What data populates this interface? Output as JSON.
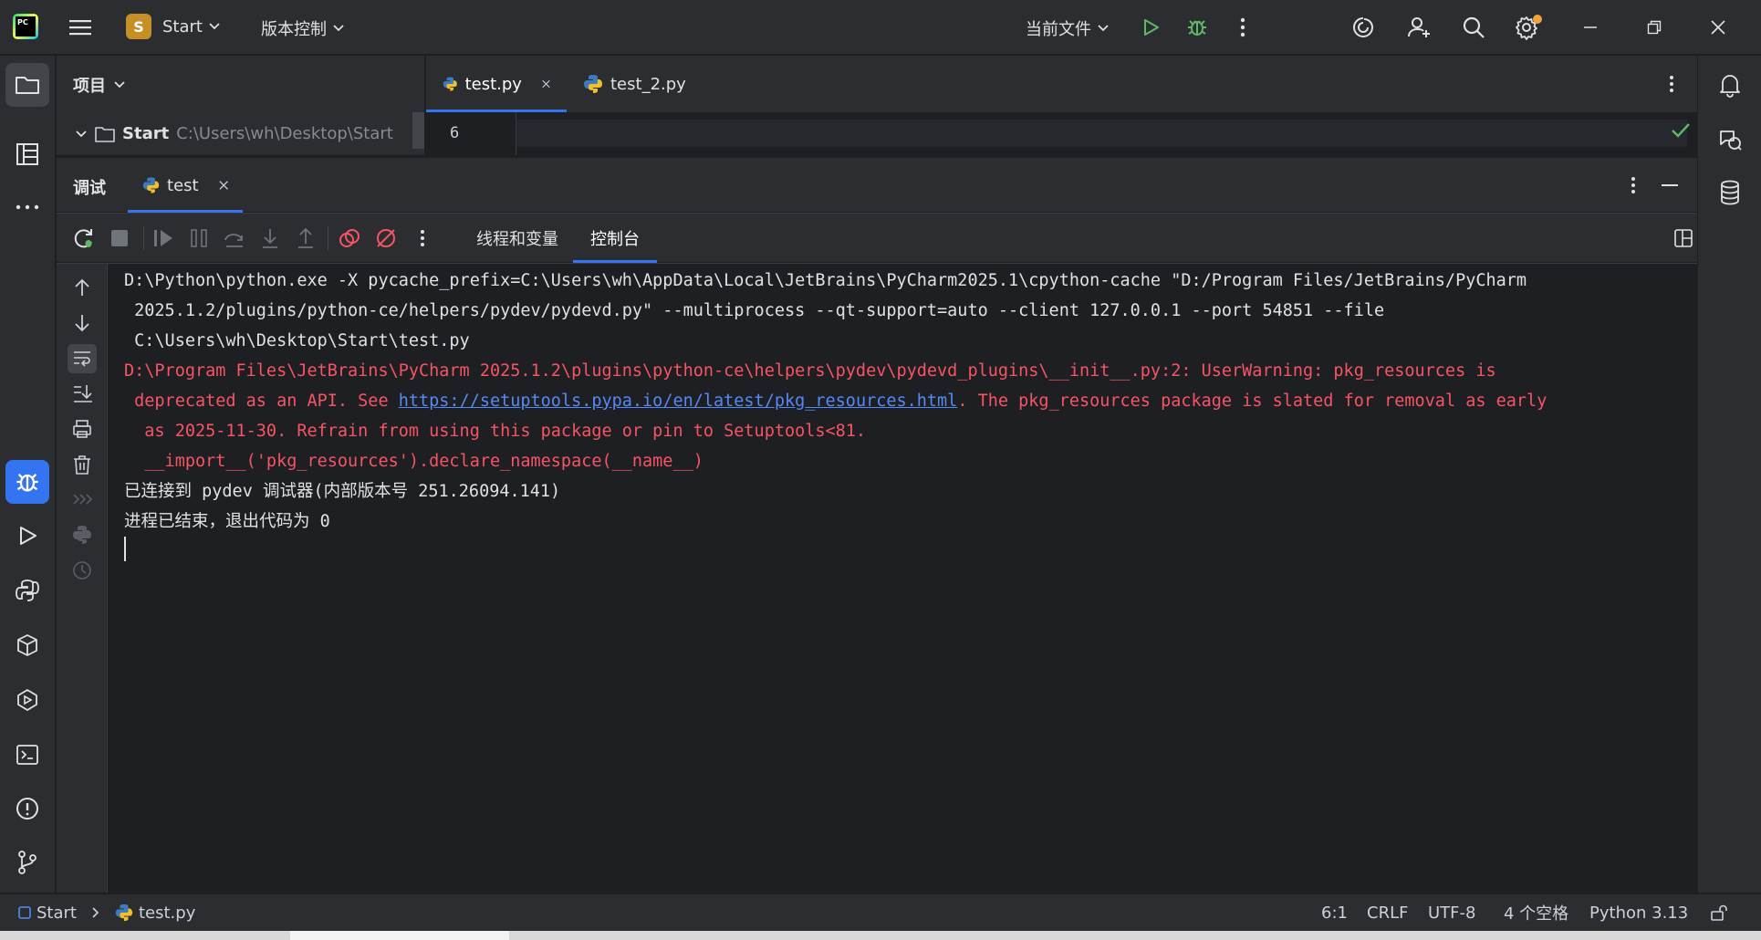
{
  "titlebar": {
    "app_logo": "PC",
    "project_badge": "S",
    "project_name": "Start",
    "vcs_menu": "版本控制",
    "run_config": "当前文件"
  },
  "project_panel": {
    "title": "项目",
    "root_name": "Start",
    "root_path": "C:\\Users\\wh\\Desktop\\Start"
  },
  "editor": {
    "tabs": [
      {
        "label": "test.py"
      },
      {
        "label": "test_2.py"
      }
    ],
    "line_number": "6"
  },
  "debug_panel": {
    "title": "调试",
    "session_tab": "test",
    "subtabs": [
      {
        "label": "线程和变量"
      },
      {
        "label": "控制台"
      }
    ]
  },
  "console": {
    "lines": [
      {
        "text": "D:\\Python\\python.exe -X pycache_prefix=C:\\Users\\wh\\AppData\\Local\\JetBrains\\PyCharm2025.1\\cpython-cache \"D:/Program Files/JetBrains/PyCharm",
        "style": "white"
      },
      {
        "text": " 2025.1.2/plugins/python-ce/helpers/pydev/pydevd.py\" --multiprocess --qt-support=auto --client 127.0.0.1 --port 54851 --file",
        "style": "white"
      },
      {
        "text": " C:\\Users\\wh\\Desktop\\Start\\test.py",
        "style": "white"
      },
      {
        "text": "D:\\Program Files\\JetBrains\\PyCharm 2025.1.2\\plugins\\python-ce\\helpers\\pydev\\pydevd_plugins\\__init__.py:2: UserWarning: pkg_resources is",
        "style": "red"
      },
      {
        "text_before": " deprecated as an API. See ",
        "link": "https://setuptools.pypa.io/en/latest/pkg_resources.html",
        "text_after": ". The pkg_resources package is slated for removal as early",
        "style": "red"
      },
      {
        "text": "  as 2025-11-30. Refrain from using this package or pin to Setuptools<81.",
        "style": "red"
      },
      {
        "text": "  __import__('pkg_resources').declare_namespace(__name__)",
        "style": "red"
      },
      {
        "text": "已连接到 pydev 调试器(内部版本号 251.26094.141)",
        "style": "white"
      },
      {
        "text": "进程已结束，退出代码为 0",
        "style": "white"
      }
    ]
  },
  "statusbar": {
    "breadcrumb_root": "Start",
    "breadcrumb_file": "test.py",
    "position": "6:1",
    "line_ending": "CRLF",
    "encoding": "UTF-8",
    "indent": "4 个空格",
    "interpreter": "Python 3.13"
  },
  "colors": {
    "accent": "#3574f0",
    "run_green": "#5fb865",
    "error_red": "#f75464",
    "link_blue": "#548af7",
    "project_badge": "#c69026"
  }
}
